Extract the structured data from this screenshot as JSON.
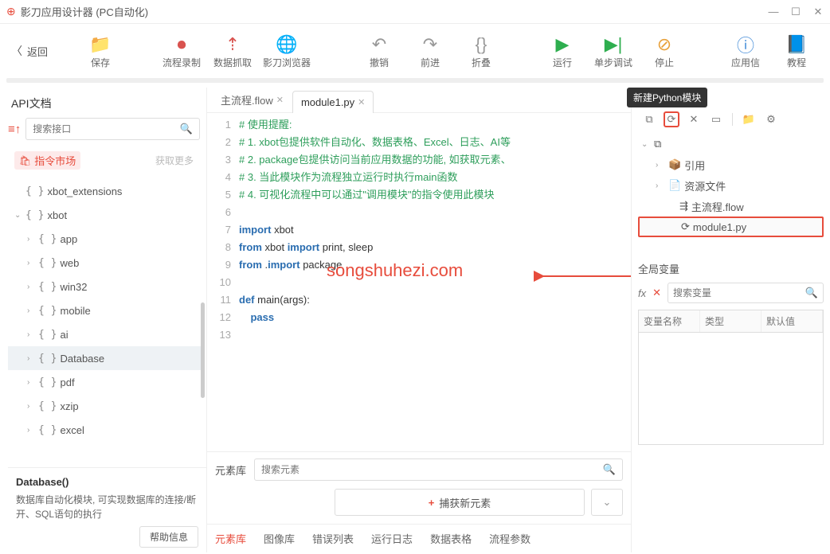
{
  "window": {
    "title": "影刀应用设计器 (PC自动化)"
  },
  "back": "返回",
  "toolbar": {
    "save": "保存",
    "record": "流程录制",
    "extract": "数据抓取",
    "browser": "影刀浏览器",
    "undo": "撤销",
    "redo": "前进",
    "fold": "折叠",
    "run": "运行",
    "step": "单步调试",
    "stop": "停止",
    "app": "应用信",
    "tutorial": "教程"
  },
  "left": {
    "title": "API文档",
    "search_placeholder": "搜索接口",
    "market": "指令市场",
    "market_more": "获取更多",
    "items": [
      {
        "label": "xbot_extensions",
        "depth": 1,
        "arrow": ""
      },
      {
        "label": "xbot",
        "depth": 1,
        "arrow": "⌄"
      },
      {
        "label": "app",
        "depth": 2,
        "arrow": "›"
      },
      {
        "label": "web",
        "depth": 2,
        "arrow": "›"
      },
      {
        "label": "win32",
        "depth": 2,
        "arrow": "›"
      },
      {
        "label": "mobile",
        "depth": 2,
        "arrow": "›"
      },
      {
        "label": "ai",
        "depth": 2,
        "arrow": "›"
      },
      {
        "label": "Database",
        "depth": 2,
        "arrow": "›",
        "selected": true
      },
      {
        "label": "pdf",
        "depth": 2,
        "arrow": "›"
      },
      {
        "label": "xzip",
        "depth": 2,
        "arrow": "›"
      },
      {
        "label": "excel",
        "depth": 2,
        "arrow": "›"
      }
    ],
    "doc_title": "Database()",
    "doc_body": "数据库自动化模块, 可实现数据库的连接/断开、SQL语句的执行",
    "help": "帮助信息"
  },
  "tabs": [
    {
      "label": "主流程.flow",
      "active": false
    },
    {
      "label": "module1.py",
      "active": true
    }
  ],
  "code": {
    "lines": [
      {
        "n": 1,
        "cls": "c-comment",
        "t": "# 使用提醒:"
      },
      {
        "n": 2,
        "cls": "c-comment",
        "t": "# 1. xbot包提供软件自动化、数据表格、Excel、日志、AI等"
      },
      {
        "n": 3,
        "cls": "c-comment",
        "t": "# 2. package包提供访问当前应用数据的功能, 如获取元素、"
      },
      {
        "n": 4,
        "cls": "c-comment",
        "t": "# 3. 当此模块作为流程独立运行时执行main函数"
      },
      {
        "n": 5,
        "cls": "c-comment",
        "t": "# 4. 可视化流程中可以通过\"调用模块\"的指令使用此模块"
      },
      {
        "n": 6,
        "cls": "",
        "t": ""
      },
      {
        "n": 7,
        "cls": "",
        "t": "<span class='c-kw'>import</span> xbot"
      },
      {
        "n": 8,
        "cls": "",
        "t": "<span class='c-kw'>from</span> xbot <span class='c-kw'>import</span> print, sleep"
      },
      {
        "n": 9,
        "cls": "",
        "t": "<span class='c-kw'>from</span> .<span class='c-kw'>import</span> package"
      },
      {
        "n": 10,
        "cls": "",
        "t": ""
      },
      {
        "n": 11,
        "cls": "",
        "t": "<span class='c-kw'>def</span> main(args):"
      },
      {
        "n": 12,
        "cls": "",
        "t": "    <span class='c-kw'>pass</span>"
      },
      {
        "n": 13,
        "cls": "",
        "t": ""
      }
    ]
  },
  "watermark": "songshuhezi.com",
  "elements": {
    "title": "元素库",
    "search_placeholder": "搜索元素",
    "capture": "捕获新元素"
  },
  "bottom_tabs": [
    "元素库",
    "图像库",
    "错误列表",
    "运行日志",
    "数据表格",
    "流程参数"
  ],
  "right": {
    "tooltip": "新建Python模块",
    "tree": [
      {
        "label": "",
        "icon": "layers",
        "depth": 1,
        "arrow": "⌄"
      },
      {
        "label": "引用",
        "icon": "box",
        "depth": 2,
        "arrow": "›"
      },
      {
        "label": "资源文件",
        "icon": "file",
        "depth": 2,
        "arrow": "›"
      },
      {
        "label": "主流程.flow",
        "icon": "flow",
        "depth": 3
      },
      {
        "label": "module1.py",
        "icon": "py",
        "depth": 3,
        "sel": true
      }
    ],
    "globals_title": "全局变量",
    "var_search": "搜索变量",
    "cols": [
      "变量名称",
      "类型",
      "默认值"
    ]
  }
}
